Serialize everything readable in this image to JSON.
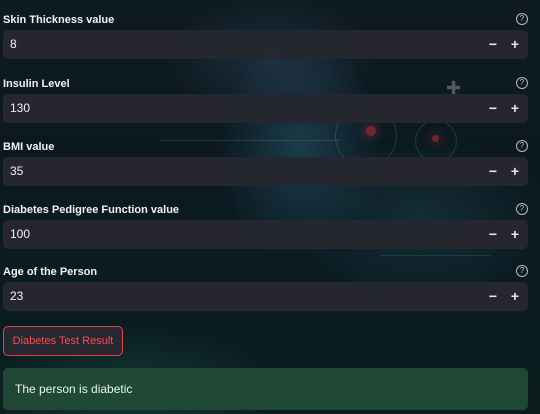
{
  "fields": [
    {
      "label": "Skin Thickness value",
      "value": "8"
    },
    {
      "label": "Insulin Level",
      "value": "130"
    },
    {
      "label": "BMI value",
      "value": "35"
    },
    {
      "label": "Diabetes Pedigree Function value",
      "value": "100"
    },
    {
      "label": "Age of the Person",
      "value": "23"
    }
  ],
  "controls": {
    "minus": "−",
    "plus": "+",
    "help": "?"
  },
  "button": {
    "label": "Diabetes Test Result"
  },
  "result": {
    "text": "The person is diabetic"
  },
  "colors": {
    "accent": "#ff4b4b",
    "input_bg": "#262730",
    "success_bg": "#214b37"
  },
  "icons": [
    "help-circle-icon",
    "minus-icon",
    "plus-icon"
  ]
}
